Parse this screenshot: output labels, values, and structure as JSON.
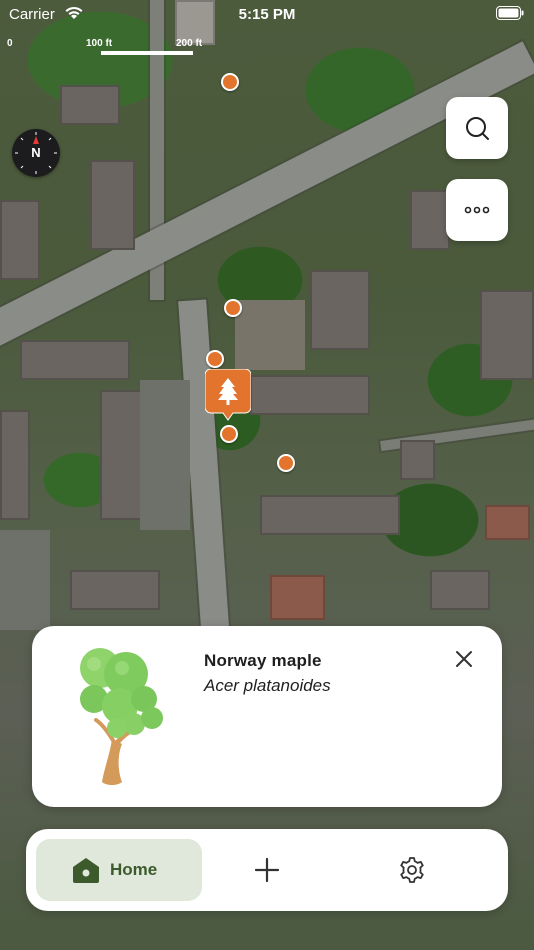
{
  "status_bar": {
    "carrier": "Carrier",
    "time": "5:15 PM",
    "icons": [
      "wifi-icon",
      "battery-icon"
    ]
  },
  "map": {
    "scale": {
      "labels": [
        "0",
        "100 ft",
        "200 ft"
      ]
    },
    "compass": {
      "letter": "N",
      "icon": "compass-icon"
    },
    "buttons": [
      {
        "name": "search",
        "icon": "search-icon"
      },
      {
        "name": "more",
        "icon": "more-icon"
      }
    ],
    "marker_color": "#e3742e",
    "selected_marker_icon": "tree-icon"
  },
  "tree_card": {
    "common_name": "Norway maple",
    "scientific_name": "Acer platanoides",
    "illustration": "tree-illustration",
    "close_icon": "close-icon"
  },
  "tab_bar": {
    "home_label": "Home",
    "home_icon": "home-icon",
    "add_icon": "plus-icon",
    "settings_icon": "gear-icon",
    "active_tab": "Home",
    "accent_color": "#3d5a2c",
    "active_bg": "#dfe8da"
  }
}
